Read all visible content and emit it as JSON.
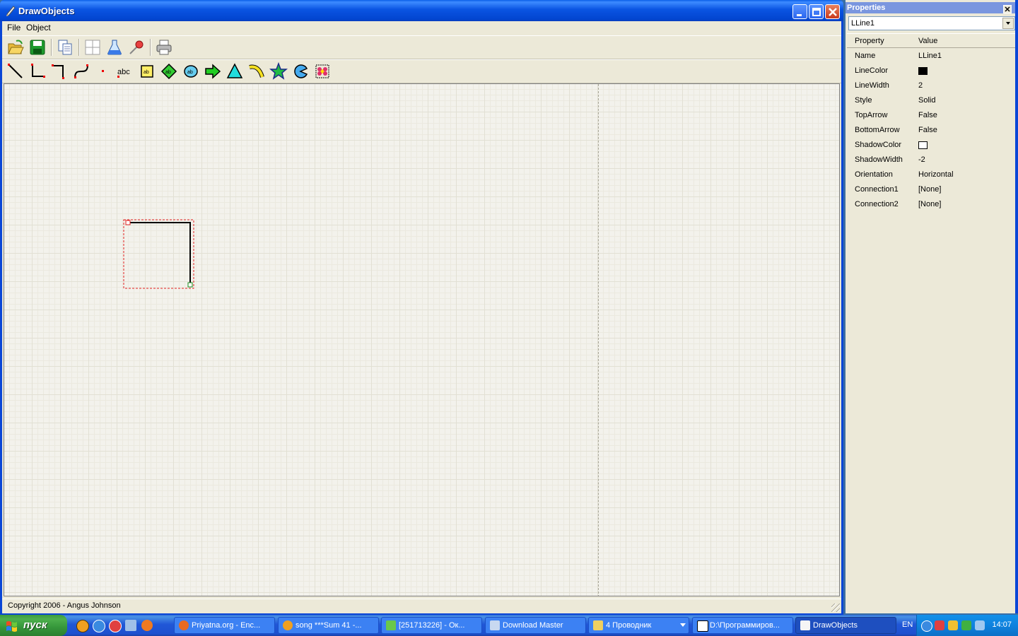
{
  "window": {
    "title": "DrawObjects",
    "menu": [
      "File",
      "Object"
    ],
    "status_text": "Copyright 2006 - Angus Johnson",
    "toolbar_icons": [
      "open-folder-icon",
      "save-icon",
      "copy-icon",
      "grid-icon",
      "flask-icon",
      "pin-icon",
      "print-icon"
    ],
    "shape_tools": [
      "line-tool",
      "l-line-tool",
      "z-line-tool",
      "bezier-line-tool",
      "dot-tool",
      "text-tool",
      "rectangle-text-tool",
      "diamond-tool",
      "ellipse-tool",
      "arrow-tool",
      "triangle-tool",
      "arc-tool",
      "star-tool",
      "pie-tool",
      "bitmap-tool"
    ]
  },
  "properties_panel": {
    "title": "Properties",
    "selected_object": "LLine1",
    "header_property": "Property",
    "header_value": "Value",
    "rows": [
      {
        "name": "Name",
        "value": "LLine1"
      },
      {
        "name": "LineColor",
        "swatch": "#000000"
      },
      {
        "name": "LineWidth",
        "value": "2"
      },
      {
        "name": "Style",
        "value": "Solid"
      },
      {
        "name": "TopArrow",
        "value": "False"
      },
      {
        "name": "BottomArrow",
        "value": "False"
      },
      {
        "name": "ShadowColor",
        "swatch": "#ffffff"
      },
      {
        "name": "ShadowWidth",
        "value": "-2"
      },
      {
        "name": "Orientation",
        "value": "Horizontal"
      },
      {
        "name": "Connection1",
        "value": "[None]"
      },
      {
        "name": "Connection2",
        "value": "[None]"
      }
    ]
  },
  "taskbar": {
    "start_label": "пуск",
    "tasks": [
      {
        "label": "Priyatna.org - Enc..."
      },
      {
        "label": "song ***Sum 41 -..."
      },
      {
        "label": "[251713226] - Ок..."
      },
      {
        "label": "Download Master"
      },
      {
        "label": "4 Проводник"
      },
      {
        "label": "D:\\Программиров..."
      },
      {
        "label": "DrawObjects"
      }
    ],
    "language": "EN",
    "clock": "14:07"
  }
}
